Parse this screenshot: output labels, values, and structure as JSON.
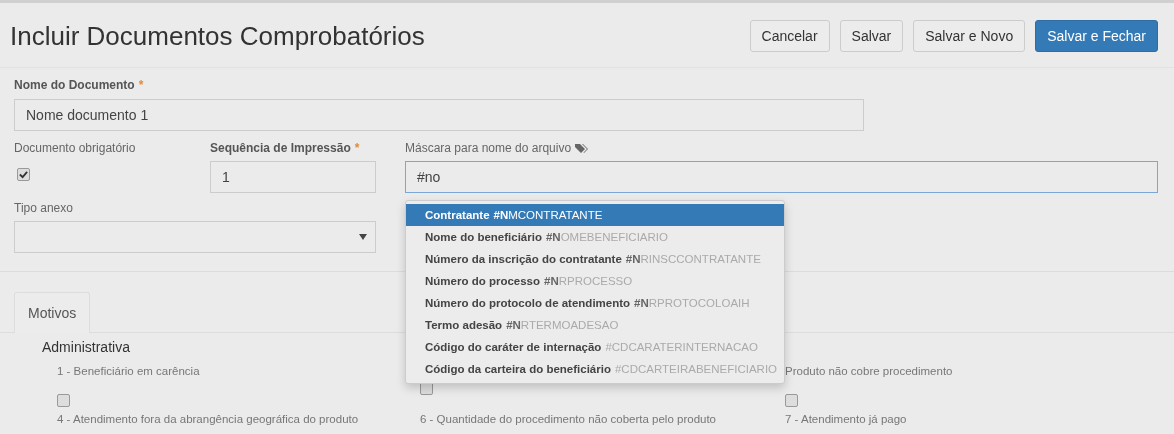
{
  "header": {
    "title": "Incluir Documentos Comprobatórios",
    "buttons": [
      {
        "label": "Cancelar",
        "kind": "default"
      },
      {
        "label": "Salvar",
        "kind": "default"
      },
      {
        "label": "Salvar e Novo",
        "kind": "default"
      },
      {
        "label": "Salvar e Fechar",
        "kind": "primary"
      }
    ]
  },
  "form": {
    "document_name": {
      "label": "Nome do Documento",
      "required_mark": "*",
      "value": "Nome documento 1"
    },
    "mandatory": {
      "label": "Documento obrigatório",
      "checked": true
    },
    "print_sequence": {
      "label": "Sequência de Impressão",
      "required_mark": "*",
      "value": "1"
    },
    "file_mask": {
      "label": "Máscara para nome do arquivo",
      "value": "#no",
      "focused": true
    },
    "attachment_type": {
      "label": "Tipo anexo"
    }
  },
  "autocomplete": [
    {
      "label": "Contratante",
      "code": "**#N**MCONTRATANTE",
      "selected": true
    },
    {
      "label": "Nome do beneficiário",
      "code": "**#N**OMEBENEFICIARIO",
      "selected": false
    },
    {
      "label": "Número da inscrição do contratante",
      "code": "**#N**RINSCCONTRATANTE",
      "selected": false
    },
    {
      "label": "Número do processo",
      "code": "**#N**RPROCESSO",
      "selected": false
    },
    {
      "label": "Número do protocolo de atendimento",
      "code": "**#N**RPROTOCOLOAIH",
      "selected": false
    },
    {
      "label": "Termo adesão",
      "code": "**#N**RTERMOADESAO",
      "selected": false
    },
    {
      "label": "Código do caráter de internação",
      "code": "#CDCARATERINTERNACAO",
      "selected": false
    },
    {
      "label": "Código da carteira do beneficiário",
      "code": "#CDCARTEIRABENEFICIARIO",
      "selected": false
    }
  ],
  "tabs": [
    {
      "label": "Motivos",
      "selected": true
    }
  ],
  "section": {
    "title": "Administrativa",
    "reasons": [
      {
        "label": "1 - Beneficiário em carência",
        "checked": false
      },
      {
        "checked": false
      },
      {
        "label": "Produto não cobre procedimento",
        "checked": false
      },
      {
        "label": "4 - Atendimento fora da abrangência geográfica do produto"
      },
      {
        "label": "6 - Quantidade do procedimento não coberta pelo produto"
      },
      {
        "label": "7 - Atendimento já pago"
      }
    ]
  }
}
